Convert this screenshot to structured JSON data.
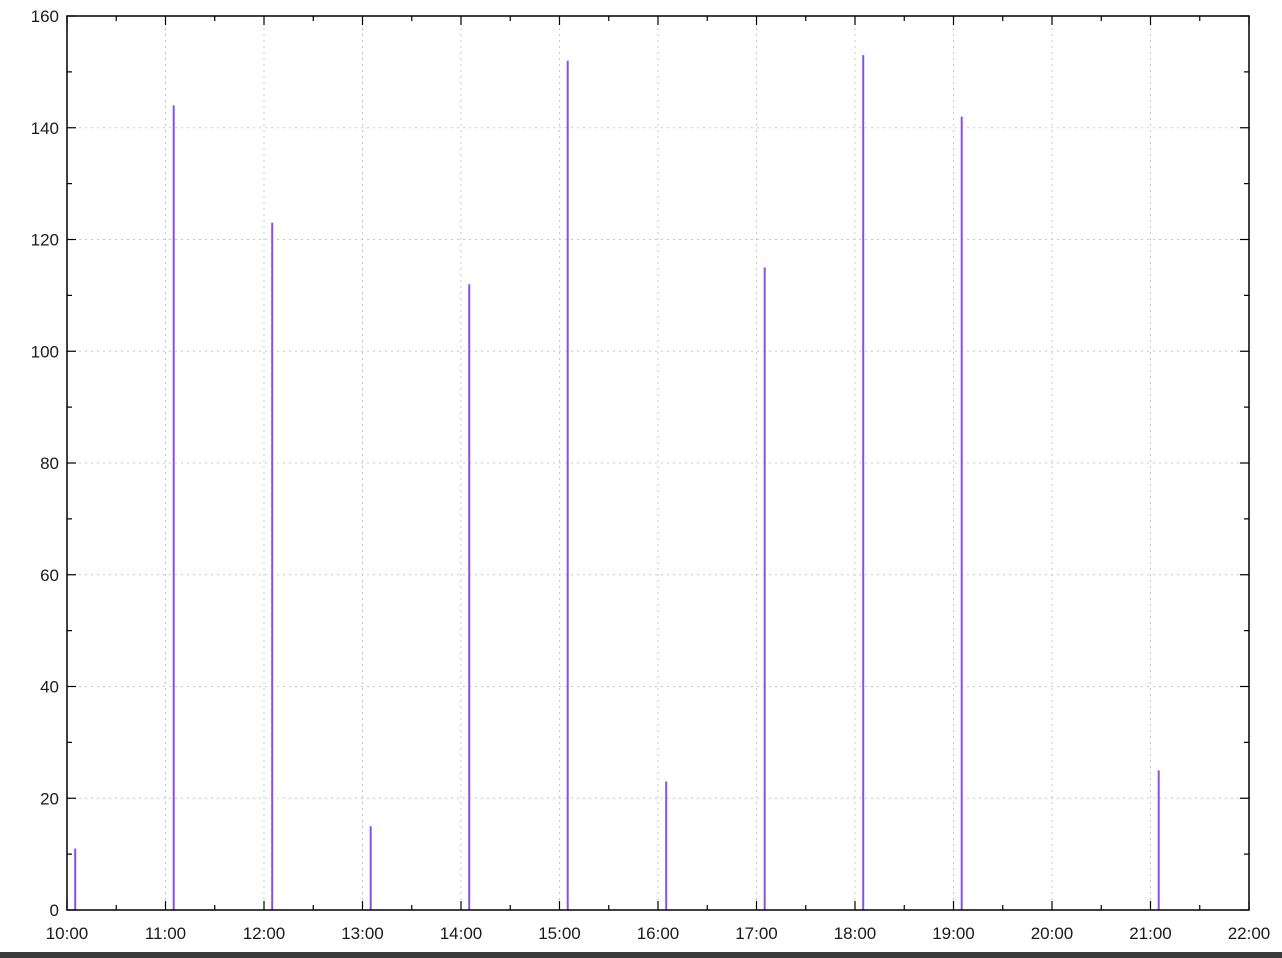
{
  "chart_data": {
    "type": "bar",
    "title": "",
    "xlabel": "",
    "ylabel": "",
    "x_ticks": [
      "10:00",
      "11:00",
      "12:00",
      "13:00",
      "14:00",
      "15:00",
      "16:00",
      "17:00",
      "18:00",
      "19:00",
      "20:00",
      "21:00",
      "22:00"
    ],
    "y_ticks": [
      0,
      20,
      40,
      60,
      80,
      100,
      120,
      140,
      160
    ],
    "xlim": [
      "10:00",
      "22:00"
    ],
    "ylim": [
      0,
      160
    ],
    "grid": true,
    "series": [
      {
        "color": "#8a4fe6",
        "points": [
          {
            "x": "10:05",
            "y": 11
          },
          {
            "x": "11:05",
            "y": 144
          },
          {
            "x": "12:05",
            "y": 123
          },
          {
            "x": "13:05",
            "y": 15
          },
          {
            "x": "14:05",
            "y": 112
          },
          {
            "x": "15:05",
            "y": 152
          },
          {
            "x": "16:05",
            "y": 23
          },
          {
            "x": "17:05",
            "y": 115
          },
          {
            "x": "18:05",
            "y": 153
          },
          {
            "x": "19:05",
            "y": 142
          },
          {
            "x": "21:05",
            "y": 25
          }
        ]
      }
    ]
  }
}
